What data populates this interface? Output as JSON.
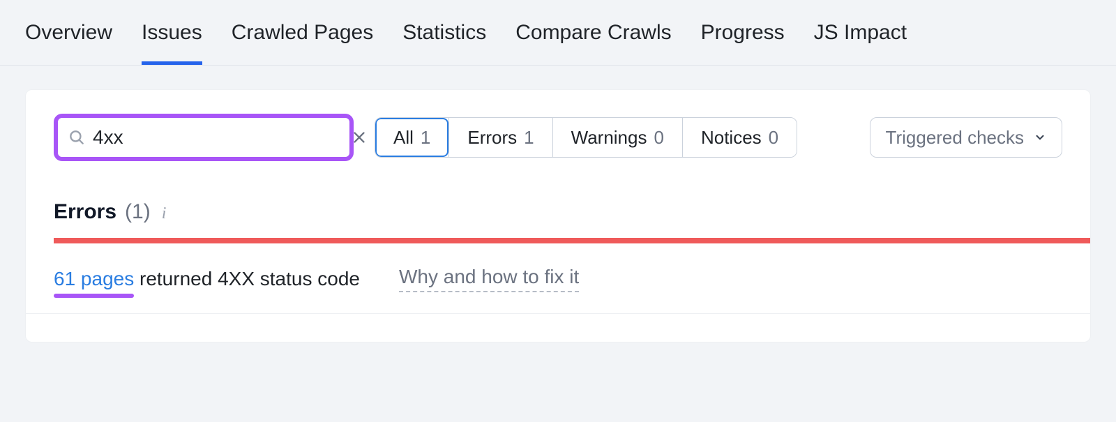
{
  "tabs": {
    "overview": "Overview",
    "issues": "Issues",
    "crawled_pages": "Crawled Pages",
    "statistics": "Statistics",
    "compare_crawls": "Compare Crawls",
    "progress": "Progress",
    "js_impact": "JS Impact",
    "active": "issues"
  },
  "search": {
    "value": "4xx",
    "placeholder": ""
  },
  "filters": {
    "all": {
      "label": "All",
      "count": "1"
    },
    "errors": {
      "label": "Errors",
      "count": "1"
    },
    "warnings": {
      "label": "Warnings",
      "count": "0"
    },
    "notices": {
      "label": "Notices",
      "count": "0"
    },
    "active": "all"
  },
  "dropdown": {
    "label": "Triggered checks"
  },
  "section": {
    "title": "Errors",
    "count": "(1)"
  },
  "issue": {
    "link_text": "61 pages",
    "rest_text": " returned 4XX status code",
    "fix_text": "Why and how to fix it"
  },
  "colors": {
    "accent_purple": "#a855f7",
    "link_blue": "#2a7de1",
    "error_red": "#ef5a5a"
  }
}
